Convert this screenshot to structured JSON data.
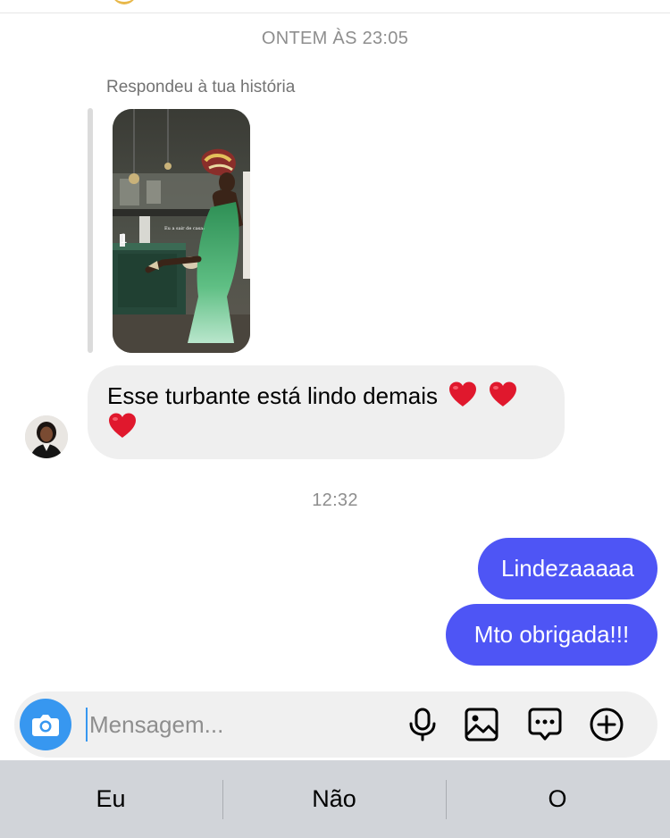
{
  "conversation": {
    "timestamp_1": "ONTEM ÀS 23:05",
    "reply_label": "Respondeu à tua história",
    "story_overlay_text": "Eu a sair de casa:",
    "incoming_message": "Esse turbante está lindo demais",
    "incoming_emoji": "heart-emoji",
    "timestamp_2": "12:32",
    "outgoing_messages": [
      "Lindezaaaaa",
      "Mto obrigada!!!"
    ]
  },
  "composer": {
    "placeholder": "Mensagem...",
    "icons": [
      "camera-icon",
      "microphone-icon",
      "gallery-icon",
      "sticker-icon",
      "plus-icon"
    ]
  },
  "keyboard": {
    "suggestions": [
      "Eu",
      "Não",
      "O"
    ]
  },
  "colors": {
    "outgoing_bubble": "#4e55f5",
    "incoming_bubble": "#efefef",
    "camera_button": "#3797f0",
    "heart": "#e0182d"
  }
}
